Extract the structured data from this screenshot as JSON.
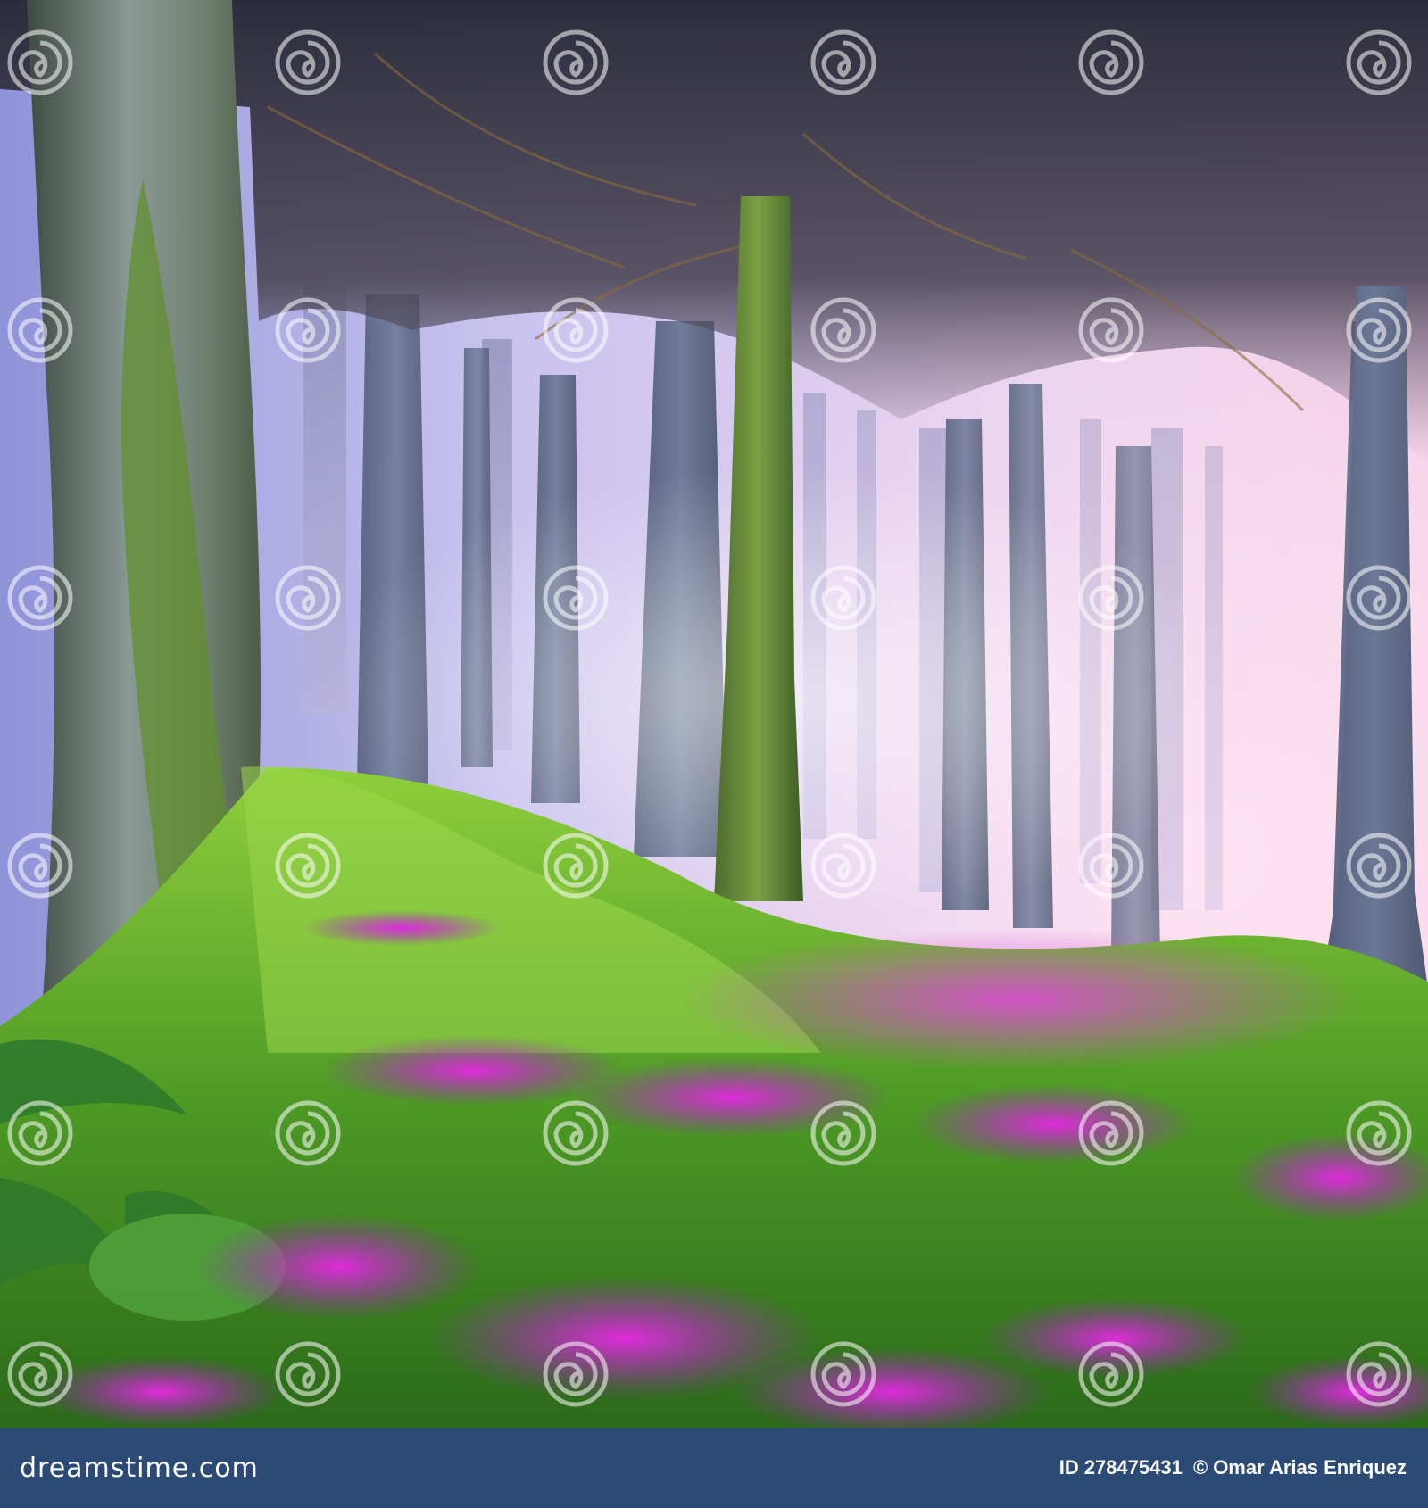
{
  "photo": {
    "subject": "misty fairy forest with mossy tree trunks, ferns and a carpet of magenta wildflowers",
    "palette": {
      "sky_haze": "#c9c3ee",
      "pink_glow": "#f2c6e8",
      "trunk": "#5e6b86",
      "moss": "#6fae2e",
      "grass": "#3f8f24",
      "flower": "#c21fd0",
      "footer_bar": "#2b4a75"
    }
  },
  "watermark": {
    "brand_text": "dreamstime",
    "icon": "spiral-icon"
  },
  "footer": {
    "brand": "dreamstime.com",
    "id_label": "ID",
    "id_value": "278475431",
    "copyright": "©",
    "author": "Omar Arias Enriquez"
  }
}
